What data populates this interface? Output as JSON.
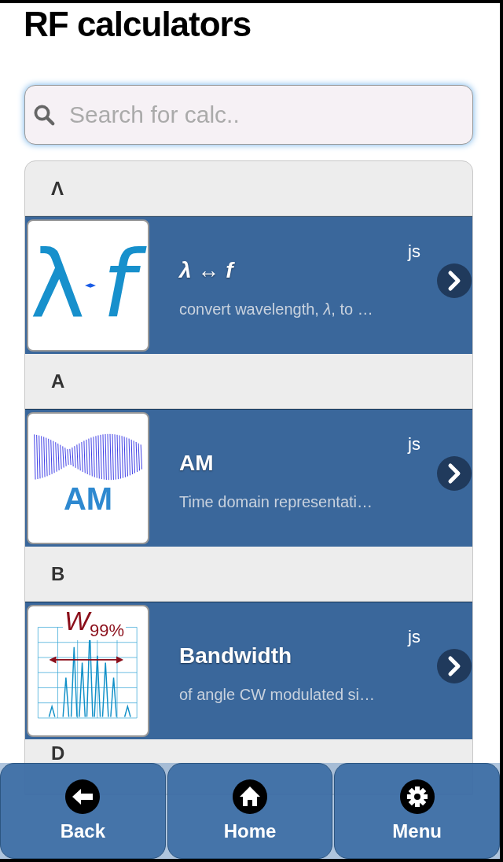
{
  "title": "RF calculators",
  "search": {
    "placeholder": "Search for calc.."
  },
  "sections": [
    {
      "letter": "Λ",
      "items": [
        {
          "kind": "lambda-f",
          "thumb_text": [
            "λ",
            "f"
          ],
          "title": "*λ* ↔ *f*",
          "tag": "js",
          "description": "convert wavelength, *λ*, to …"
        }
      ]
    },
    {
      "letter": "A",
      "items": [
        {
          "kind": "am",
          "thumb_text": [
            "AM"
          ],
          "title": "AM",
          "tag": "js",
          "description": "Time domain representati…"
        }
      ]
    },
    {
      "letter": "B",
      "items": [
        {
          "kind": "bandwidth",
          "thumb_text": [
            "*W*$_{99%}$"
          ],
          "title": "Bandwidth",
          "tag": "js",
          "description": "of angle CW modulated si…"
        }
      ]
    },
    {
      "letter": "D"
    }
  ],
  "footer": [
    {
      "kind": "back",
      "label": "Back"
    },
    {
      "kind": "home",
      "label": "Home"
    },
    {
      "kind": "gear",
      "label": "Menu"
    }
  ]
}
